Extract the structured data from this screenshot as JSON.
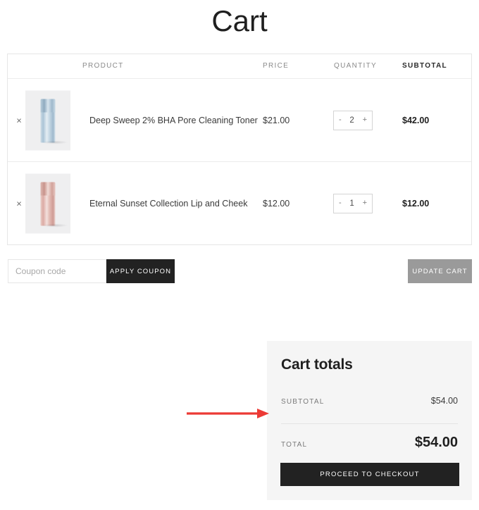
{
  "page": {
    "title": "Cart"
  },
  "cart_table": {
    "columns": {
      "remove": "",
      "product": "PRODUCT",
      "price": "PRICE",
      "quantity": "QUANTITY",
      "subtotal": "SUBTOTAL"
    },
    "remove_glyph": "×",
    "qty_decrement": "-",
    "qty_increment": "+",
    "items": [
      {
        "name": "Deep Sweep 2% BHA Pore Cleaning Toner",
        "price": "$21.00",
        "quantity": "2",
        "subtotal": "$42.00",
        "thumb_color": "#aac4d6"
      },
      {
        "name": "Eternal Sunset Collection Lip and Cheek",
        "price": "$12.00",
        "quantity": "1",
        "subtotal": "$12.00",
        "thumb_color": "#dcaba4"
      }
    ]
  },
  "coupon": {
    "placeholder": "Coupon code",
    "value": "",
    "apply_label": "Apply coupon"
  },
  "actions": {
    "update_cart_label": "Update cart"
  },
  "cart_totals": {
    "title": "Cart totals",
    "subtotal_label": "Subtotal",
    "subtotal_value": "$54.00",
    "total_label": "Total",
    "total_value": "$54.00",
    "checkout_label": "Proceed to checkout"
  },
  "annotation": {
    "arrow_color": "#ec3a35",
    "points_to": "cart-totals"
  }
}
